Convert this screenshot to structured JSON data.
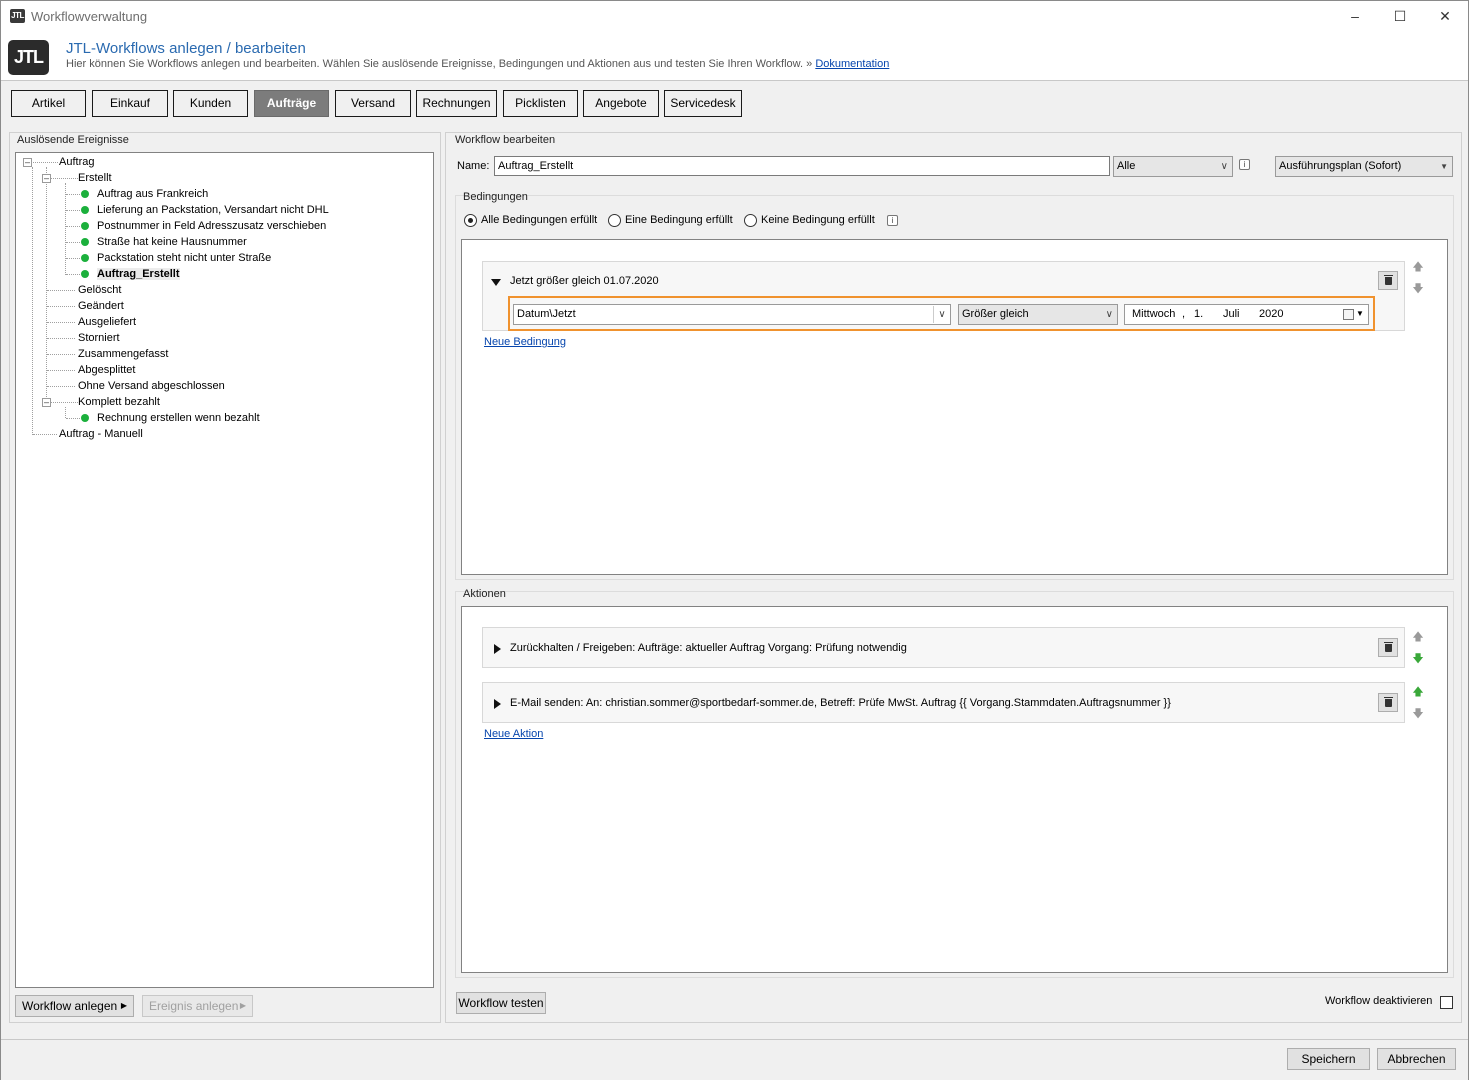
{
  "window": {
    "title": "Workflowverwaltung"
  },
  "header": {
    "title": "JTL-Workflows anlegen / bearbeiten",
    "subtitle": "Hier können Sie Workflows anlegen und bearbeiten. Wählen Sie auslösende Ereignisse, Bedingungen und Aktionen aus und testen Sie Ihren Workflow.",
    "link_prefix": "»",
    "link": "Dokumentation",
    "logo_text": "JTL"
  },
  "tabs": [
    {
      "label": "Artikel"
    },
    {
      "label": "Einkauf"
    },
    {
      "label": "Kunden"
    },
    {
      "label": "Aufträge",
      "active": true
    },
    {
      "label": "Versand"
    },
    {
      "label": "Rechnungen"
    },
    {
      "label": "Picklisten"
    },
    {
      "label": "Angebote"
    },
    {
      "label": "Servicedesk"
    }
  ],
  "events": {
    "label": "Auslösende Ereignisse",
    "tree": {
      "root": "Auftrag",
      "erstellt": "Erstellt",
      "erstellt_children": [
        "Auftrag aus Frankreich",
        "Lieferung an Packstation, Versandart nicht DHL",
        "Postnummer in Feld Adresszusatz verschieben",
        "Straße hat keine Hausnummer",
        "Packstation steht nicht unter Straße",
        "Auftrag_Erstellt"
      ],
      "siblings": [
        "Gelöscht",
        "Geändert",
        "Ausgeliefert",
        "Storniert",
        "Zusammengefasst",
        "Abgesplittet",
        "Ohne Versand abgeschlossen"
      ],
      "komplett": "Komplett bezahlt",
      "komplett_children": [
        "Rechnung erstellen wenn bezahlt"
      ],
      "manual": "Auftrag - Manuell"
    },
    "btn_create": "Workflow anlegen",
    "btn_event": "Ereignis anlegen"
  },
  "workflow": {
    "label": "Workflow bearbeiten",
    "name_label": "Name:",
    "name_value": "Auftrag_Erstellt",
    "scope_value": "Alle",
    "plan_value": "Ausführungsplan (Sofort)",
    "info_glyph": "i"
  },
  "conditions": {
    "label": "Bedingungen",
    "radio_all": "Alle Bedingungen erfüllt",
    "radio_one": "Eine Bedingung erfüllt",
    "radio_none": "Keine Bedingung erfüllt",
    "card_title": "Jetzt größer gleich 01.07.2020",
    "field_value": "Datum\\Jetzt",
    "operator_value": "Größer gleich",
    "date": {
      "weekday": "Mittwoch",
      "day": "1.",
      "month": "Juli",
      "year": "2020",
      "sep": ","
    },
    "new_link": "Neue Bedingung"
  },
  "actions": {
    "label": "Aktionen",
    "items": [
      "Zurückhalten / Freigeben: Aufträge: aktueller Auftrag Vorgang: Prüfung notwendig",
      "E-Mail senden: An: christian.sommer@sportbedarf-sommer.de, Betreff: Prüfe MwSt. Auftrag {{ Vorgang.Stammdaten.Auftragsnummer }}"
    ],
    "new_link": "Neue Aktion"
  },
  "footer": {
    "btn_test": "Workflow testen",
    "deactivate": "Workflow deaktivieren",
    "save": "Speichern",
    "cancel": "Abbrechen"
  },
  "colors": {
    "accent": "#f0922e",
    "link": "#0645ad",
    "dot": "#1bb03c"
  }
}
